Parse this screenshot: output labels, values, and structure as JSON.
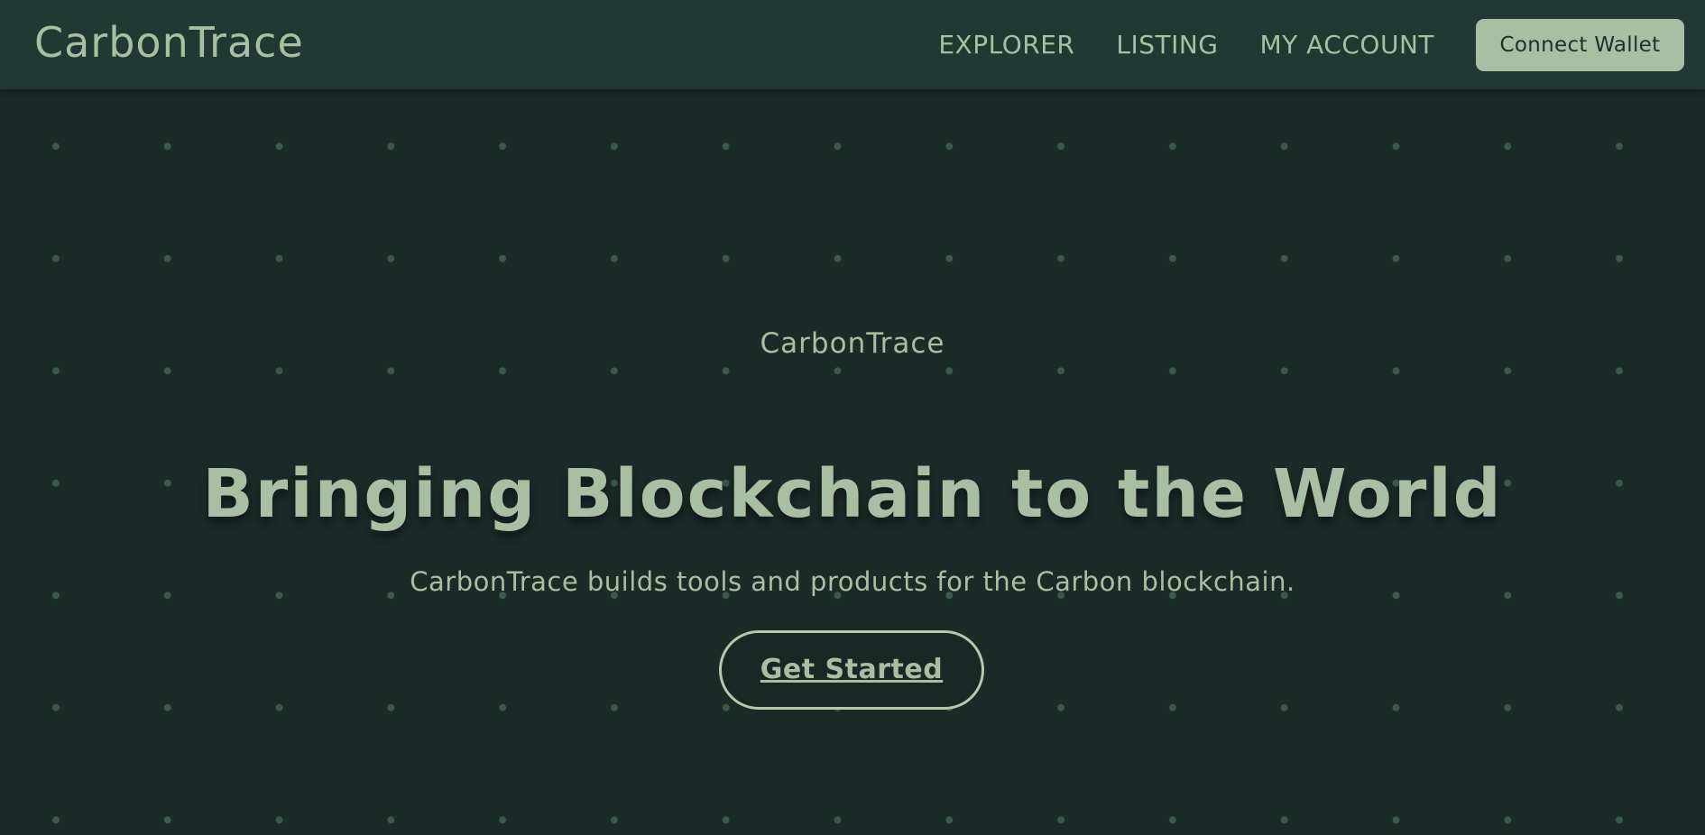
{
  "app": {
    "brand": "CarbonTrace"
  },
  "nav": {
    "items": [
      {
        "label": "EXPLORER"
      },
      {
        "label": "LISTING"
      },
      {
        "label": "MY ACCOUNT"
      }
    ],
    "connect_wallet_label": "Connect Wallet"
  },
  "hero": {
    "eyebrow": "CarbonTrace",
    "title": "Bringing Blockchain to the World",
    "subtitle": "CarbonTrace builds tools and products for the Carbon blockchain.",
    "cta_label": "Get Started"
  },
  "colors": {
    "background": "#1b2b28",
    "navbar": "#223833",
    "accent": "#a9bfa3",
    "dot": "#3c5a4a"
  }
}
